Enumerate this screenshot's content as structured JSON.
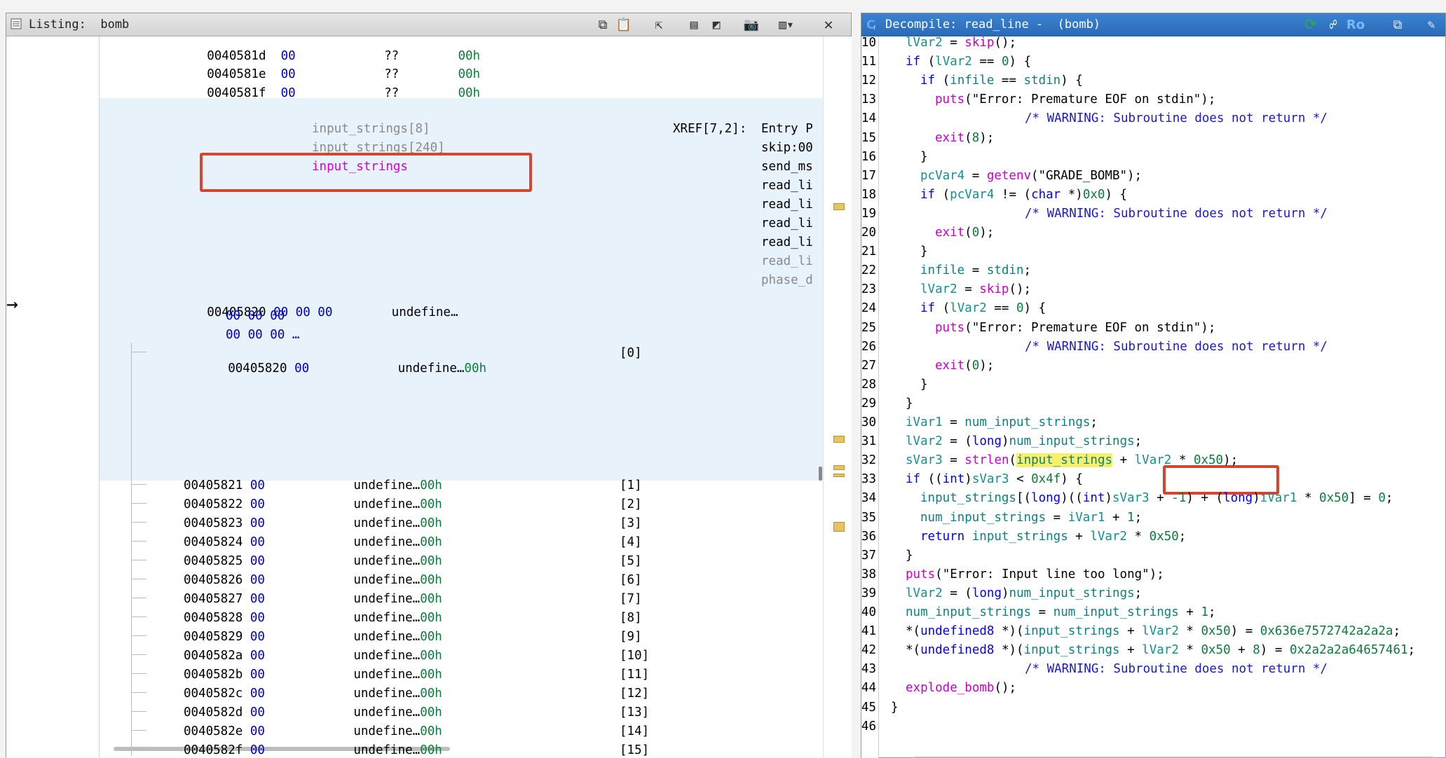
{
  "listing": {
    "title": "Listing:  bomb",
    "top_rows": [
      {
        "addr": "0040581d",
        "byte": "00",
        "qq": "??",
        "hex": "00h"
      },
      {
        "addr": "0040581e",
        "byte": "00",
        "qq": "??",
        "hex": "00h"
      },
      {
        "addr": "0040581f",
        "byte": "00",
        "qq": "??",
        "hex": "00h"
      }
    ],
    "labels": [
      "input_strings[8]",
      "input_strings[240]",
      "input_strings"
    ],
    "xref_label": "XREF[7,2]:",
    "xrefs": [
      "Entry P",
      "skip:00",
      "send_ms",
      "read_li",
      "read_li",
      "read_li",
      "read_li",
      "read_li",
      "phase_d"
    ],
    "main_row": {
      "addr": "00405820",
      "bytes": [
        "00 00 00",
        "00 00 00",
        "00 00 00 …"
      ],
      "type": "undefine…"
    },
    "first_elem": {
      "addr": "00405820",
      "byte": "00",
      "type": "undefine…",
      "hex": "00h",
      "idx": "[0]"
    },
    "elems": [
      {
        "addr": "00405821",
        "idx": "[1]"
      },
      {
        "addr": "00405822",
        "idx": "[2]"
      },
      {
        "addr": "00405823",
        "idx": "[3]"
      },
      {
        "addr": "00405824",
        "idx": "[4]"
      },
      {
        "addr": "00405825",
        "idx": "[5]"
      },
      {
        "addr": "00405826",
        "idx": "[6]"
      },
      {
        "addr": "00405827",
        "idx": "[7]"
      },
      {
        "addr": "00405828",
        "idx": "[8]"
      },
      {
        "addr": "00405829",
        "idx": "[9]"
      },
      {
        "addr": "0040582a",
        "idx": "[10]"
      },
      {
        "addr": "0040582b",
        "idx": "[11]"
      },
      {
        "addr": "0040582c",
        "idx": "[12]"
      },
      {
        "addr": "0040582d",
        "idx": "[13]"
      },
      {
        "addr": "0040582e",
        "idx": "[14]"
      },
      {
        "addr": "0040582f",
        "idx": "[15]"
      }
    ],
    "elem_byte": "00",
    "elem_type": "undefine…",
    "elem_hex": "00h"
  },
  "decompile": {
    "title": "Decompile: read_line -  (bomb)",
    "ro_label": "Ro",
    "line_numbers": [
      "10",
      "11",
      "12",
      "13",
      "14",
      "15",
      "16",
      "17",
      "18",
      "19",
      "20",
      "21",
      "22",
      "23",
      "24",
      "25",
      "26",
      "27",
      "28",
      "29",
      "30",
      "31",
      "32",
      "33",
      "34",
      "35",
      "36",
      "37",
      "38",
      "39",
      "40",
      "41",
      "42",
      "43",
      "44",
      "45",
      "46"
    ],
    "lines": [
      [
        {
          "c": "v",
          "t": "lVar2"
        },
        {
          "c": "s",
          "t": " = "
        },
        {
          "c": "f",
          "t": "skip"
        },
        {
          "c": "s",
          "t": "();"
        }
      ],
      [
        {
          "c": "k",
          "t": "if"
        },
        {
          "c": "s",
          "t": " ("
        },
        {
          "c": "v",
          "t": "lVar2"
        },
        {
          "c": "s",
          "t": " == "
        },
        {
          "c": "n",
          "t": "0"
        },
        {
          "c": "s",
          "t": ") {"
        }
      ],
      [
        {
          "c": "k",
          "t": "if"
        },
        {
          "c": "s",
          "t": " ("
        },
        {
          "c": "g",
          "t": "infile"
        },
        {
          "c": "s",
          "t": " == "
        },
        {
          "c": "g",
          "t": "stdin"
        },
        {
          "c": "s",
          "t": ") {"
        }
      ],
      [
        {
          "c": "f",
          "t": "puts"
        },
        {
          "c": "s",
          "t": "(\"Error: Premature EOF on stdin\");"
        }
      ],
      [
        {
          "c": "c",
          "t": "/* WARNING: Subroutine does not return */"
        }
      ],
      [
        {
          "c": "f",
          "t": "exit"
        },
        {
          "c": "s",
          "t": "("
        },
        {
          "c": "n",
          "t": "8"
        },
        {
          "c": "s",
          "t": ");"
        }
      ],
      [
        {
          "c": "s",
          "t": "}"
        }
      ],
      [
        {
          "c": "v",
          "t": "pcVar4"
        },
        {
          "c": "s",
          "t": " = "
        },
        {
          "c": "f",
          "t": "getenv"
        },
        {
          "c": "s",
          "t": "(\"GRADE_BOMB\");"
        }
      ],
      [
        {
          "c": "k",
          "t": "if"
        },
        {
          "c": "s",
          "t": " ("
        },
        {
          "c": "v",
          "t": "pcVar4"
        },
        {
          "c": "s",
          "t": " != ("
        },
        {
          "c": "t",
          "t": "char"
        },
        {
          "c": "s",
          "t": " *)"
        },
        {
          "c": "n",
          "t": "0x0"
        },
        {
          "c": "s",
          "t": ") {"
        }
      ],
      [
        {
          "c": "c",
          "t": "/* WARNING: Subroutine does not return */"
        }
      ],
      [
        {
          "c": "f",
          "t": "exit"
        },
        {
          "c": "s",
          "t": "("
        },
        {
          "c": "n",
          "t": "0"
        },
        {
          "c": "s",
          "t": ");"
        }
      ],
      [
        {
          "c": "s",
          "t": "}"
        }
      ],
      [
        {
          "c": "g",
          "t": "infile"
        },
        {
          "c": "s",
          "t": " = "
        },
        {
          "c": "g",
          "t": "stdin"
        },
        {
          "c": "s",
          "t": ";"
        }
      ],
      [
        {
          "c": "v",
          "t": "lVar2"
        },
        {
          "c": "s",
          "t": " = "
        },
        {
          "c": "f",
          "t": "skip"
        },
        {
          "c": "s",
          "t": "();"
        }
      ],
      [
        {
          "c": "k",
          "t": "if"
        },
        {
          "c": "s",
          "t": " ("
        },
        {
          "c": "v",
          "t": "lVar2"
        },
        {
          "c": "s",
          "t": " == "
        },
        {
          "c": "n",
          "t": "0"
        },
        {
          "c": "s",
          "t": ") {"
        }
      ],
      [
        {
          "c": "f",
          "t": "puts"
        },
        {
          "c": "s",
          "t": "(\"Error: Premature EOF on stdin\");"
        }
      ],
      [
        {
          "c": "c",
          "t": "/* WARNING: Subroutine does not return */"
        }
      ],
      [
        {
          "c": "f",
          "t": "exit"
        },
        {
          "c": "s",
          "t": "("
        },
        {
          "c": "n",
          "t": "0"
        },
        {
          "c": "s",
          "t": ");"
        }
      ],
      [
        {
          "c": "s",
          "t": "}"
        }
      ],
      [
        {
          "c": "s",
          "t": "}"
        }
      ],
      [
        {
          "c": "v",
          "t": "iVar1"
        },
        {
          "c": "s",
          "t": " = "
        },
        {
          "c": "g",
          "t": "num_input_strings"
        },
        {
          "c": "s",
          "t": ";"
        }
      ],
      [
        {
          "c": "v",
          "t": "lVar2"
        },
        {
          "c": "s",
          "t": " = ("
        },
        {
          "c": "t",
          "t": "long"
        },
        {
          "c": "s",
          "t": ")"
        },
        {
          "c": "g",
          "t": "num_input_strings"
        },
        {
          "c": "s",
          "t": ";"
        }
      ],
      [
        {
          "c": "v",
          "t": "sVar3"
        },
        {
          "c": "s",
          "t": " = "
        },
        {
          "c": "f",
          "t": "strlen"
        },
        {
          "c": "s",
          "t": "("
        },
        {
          "c": "gh",
          "t": "input_strings"
        },
        {
          "c": "s",
          "t": " + "
        },
        {
          "c": "v",
          "t": "lVar2"
        },
        {
          "c": "s",
          "t": " * "
        },
        {
          "c": "n",
          "t": "0x50"
        },
        {
          "c": "s",
          "t": ");"
        }
      ],
      [
        {
          "c": "k",
          "t": "if"
        },
        {
          "c": "s",
          "t": " (("
        },
        {
          "c": "t",
          "t": "int"
        },
        {
          "c": "s",
          "t": ")"
        },
        {
          "c": "v",
          "t": "sVar3"
        },
        {
          "c": "s",
          "t": " < "
        },
        {
          "c": "n",
          "t": "0x4f"
        },
        {
          "c": "s",
          "t": ") {"
        }
      ],
      [
        {
          "c": "g",
          "t": "input_strings"
        },
        {
          "c": "s",
          "t": "[("
        },
        {
          "c": "t",
          "t": "long"
        },
        {
          "c": "s",
          "t": ")(("
        },
        {
          "c": "t",
          "t": "int"
        },
        {
          "c": "s",
          "t": ")"
        },
        {
          "c": "v",
          "t": "sVar3"
        },
        {
          "c": "s",
          "t": " + "
        },
        {
          "c": "n",
          "t": "-1"
        },
        {
          "c": "s",
          "t": ") + ("
        },
        {
          "c": "t",
          "t": "long"
        },
        {
          "c": "s",
          "t": ")"
        },
        {
          "c": "v",
          "t": "iVar1"
        },
        {
          "c": "s",
          "t": " * "
        },
        {
          "c": "n",
          "t": "0x50"
        },
        {
          "c": "s",
          "t": "] = "
        },
        {
          "c": "n",
          "t": "0"
        },
        {
          "c": "s",
          "t": ";"
        }
      ],
      [
        {
          "c": "g",
          "t": "num_input_strings"
        },
        {
          "c": "s",
          "t": " = "
        },
        {
          "c": "v",
          "t": "iVar1"
        },
        {
          "c": "s",
          "t": " + "
        },
        {
          "c": "n",
          "t": "1"
        },
        {
          "c": "s",
          "t": ";"
        }
      ],
      [
        {
          "c": "k",
          "t": "return"
        },
        {
          "c": "s",
          "t": " "
        },
        {
          "c": "g",
          "t": "input_strings"
        },
        {
          "c": "s",
          "t": " + "
        },
        {
          "c": "v",
          "t": "lVar2"
        },
        {
          "c": "s",
          "t": " * "
        },
        {
          "c": "n",
          "t": "0x50"
        },
        {
          "c": "s",
          "t": ";"
        }
      ],
      [
        {
          "c": "s",
          "t": "}"
        }
      ],
      [
        {
          "c": "f",
          "t": "puts"
        },
        {
          "c": "s",
          "t": "(\"Error: Input line too long\");"
        }
      ],
      [
        {
          "c": "v",
          "t": "lVar2"
        },
        {
          "c": "s",
          "t": " = ("
        },
        {
          "c": "t",
          "t": "long"
        },
        {
          "c": "s",
          "t": ")"
        },
        {
          "c": "g",
          "t": "num_input_strings"
        },
        {
          "c": "s",
          "t": ";"
        }
      ],
      [
        {
          "c": "g",
          "t": "num_input_strings"
        },
        {
          "c": "s",
          "t": " = "
        },
        {
          "c": "g",
          "t": "num_input_strings"
        },
        {
          "c": "s",
          "t": " + "
        },
        {
          "c": "n",
          "t": "1"
        },
        {
          "c": "s",
          "t": ";"
        }
      ],
      [
        {
          "c": "s",
          "t": "*("
        },
        {
          "c": "t",
          "t": "undefined8"
        },
        {
          "c": "s",
          "t": " *)("
        },
        {
          "c": "g",
          "t": "input_strings"
        },
        {
          "c": "s",
          "t": " + "
        },
        {
          "c": "v",
          "t": "lVar2"
        },
        {
          "c": "s",
          "t": " * "
        },
        {
          "c": "n",
          "t": "0x50"
        },
        {
          "c": "s",
          "t": ") = "
        },
        {
          "c": "n",
          "t": "0x636e7572742a2a2a"
        },
        {
          "c": "s",
          "t": ";"
        }
      ],
      [
        {
          "c": "s",
          "t": "*("
        },
        {
          "c": "t",
          "t": "undefined8"
        },
        {
          "c": "s",
          "t": " *)("
        },
        {
          "c": "g",
          "t": "input_strings"
        },
        {
          "c": "s",
          "t": " + "
        },
        {
          "c": "v",
          "t": "lVar2"
        },
        {
          "c": "s",
          "t": " * "
        },
        {
          "c": "n",
          "t": "0x50"
        },
        {
          "c": "s",
          "t": " + "
        },
        {
          "c": "n",
          "t": "8"
        },
        {
          "c": "s",
          "t": ") = "
        },
        {
          "c": "n",
          "t": "0x2a2a2a64657461"
        },
        {
          "c": "s",
          "t": ";"
        }
      ],
      [
        {
          "c": "c",
          "t": "/* WARNING: Subroutine does not return */"
        }
      ],
      [
        {
          "c": "f",
          "t": "explode_bomb"
        },
        {
          "c": "s",
          "t": "();"
        }
      ],
      [
        {
          "c": "s",
          "t": "}"
        }
      ],
      []
    ]
  },
  "colors": {
    "highlight_band": "#e8f2fb",
    "redbox": "#d6452f",
    "yellow_highlight": "#f6f06b",
    "decomp_titlebar": "#2a6bb8"
  }
}
